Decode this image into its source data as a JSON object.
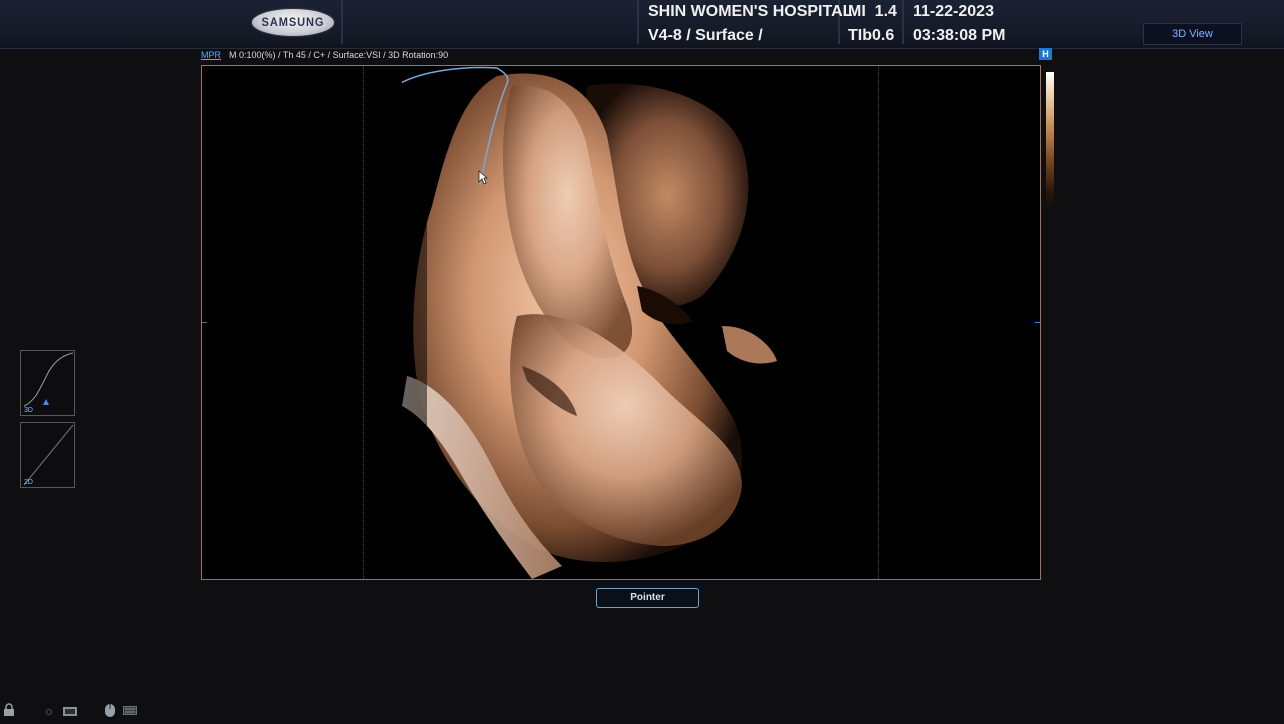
{
  "header": {
    "brand": "SAMSUNG",
    "hospital": "SHIN WOMEN'S HOSPITAL",
    "probe_preset": "V4-8 / Surface /",
    "mi": "MI  1.4",
    "tib": "TIb0.6",
    "date": "11-22-2023",
    "time": "03:38:08 PM",
    "view_button": "3D View"
  },
  "info_bar": {
    "mode": "MPR",
    "params": "M 0:100(%) / Th 45 / C+ / Surface:VSI / 3D Rotation:90",
    "h_badge": "H"
  },
  "curves": {
    "curve_3d_label": "3D",
    "curve_2d_label": "2D"
  },
  "pointer_button": "Pointer",
  "colors": {
    "accent_blue": "#5aa8ff",
    "frame_border": "#a0735e",
    "button_border": "#6da4c8",
    "skin_tone": "#d9a588"
  },
  "icons": [
    "samsung-logo",
    "h-icon",
    "lock-icon",
    "monitor-icon",
    "mouse-icon",
    "keyboard-icon",
    "pointer-cursor-icon"
  ]
}
